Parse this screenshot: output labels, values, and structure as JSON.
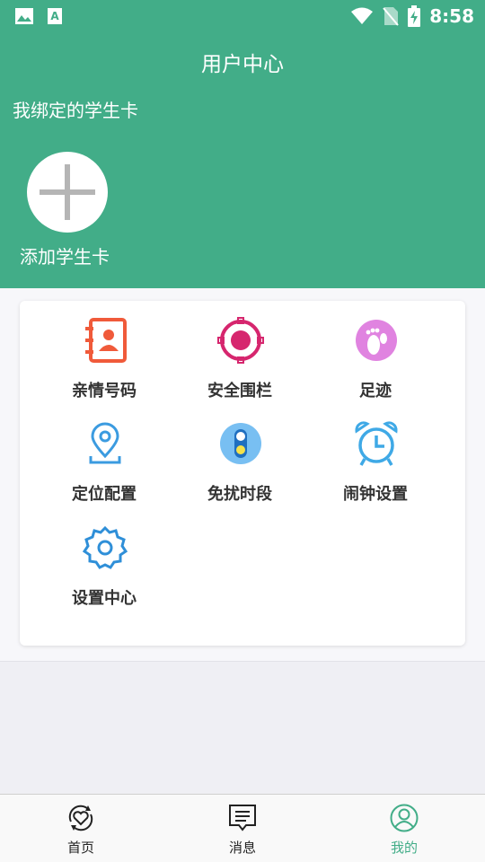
{
  "status_bar": {
    "time": "8:58",
    "icons": [
      "image-icon",
      "font-icon",
      "wifi-icon",
      "no-sim-icon",
      "battery-charging-icon"
    ]
  },
  "header": {
    "title": "用户中心",
    "bound_cards_label": "我绑定的学生卡",
    "add_card_label": "添加学生卡"
  },
  "menu": {
    "items": [
      {
        "label": "亲情号码",
        "icon": "contacts-book-icon",
        "color": "#f05a3a"
      },
      {
        "label": "安全围栏",
        "icon": "geofence-target-icon",
        "color": "#d6266e"
      },
      {
        "label": "足迹",
        "icon": "footprint-icon",
        "color": "#e083e0"
      },
      {
        "label": "定位配置",
        "icon": "location-pin-icon",
        "color": "#3b9be0"
      },
      {
        "label": "免扰时段",
        "icon": "traffic-light-icon",
        "color": "#78bff2"
      },
      {
        "label": "闹钟设置",
        "icon": "alarm-clock-icon",
        "color": "#3fa9e6"
      },
      {
        "label": "设置中心",
        "icon": "gear-icon",
        "color": "#2f8fd8"
      }
    ]
  },
  "tabbar": {
    "tabs": [
      {
        "label": "首页",
        "icon": "heart-refresh-icon"
      },
      {
        "label": "消息",
        "icon": "message-icon"
      },
      {
        "label": "我的",
        "icon": "user-icon",
        "active": true
      }
    ],
    "active_color": "#42ad88"
  },
  "colors": {
    "header_bg": "#42ad88",
    "page_bg": "#efeff4"
  }
}
